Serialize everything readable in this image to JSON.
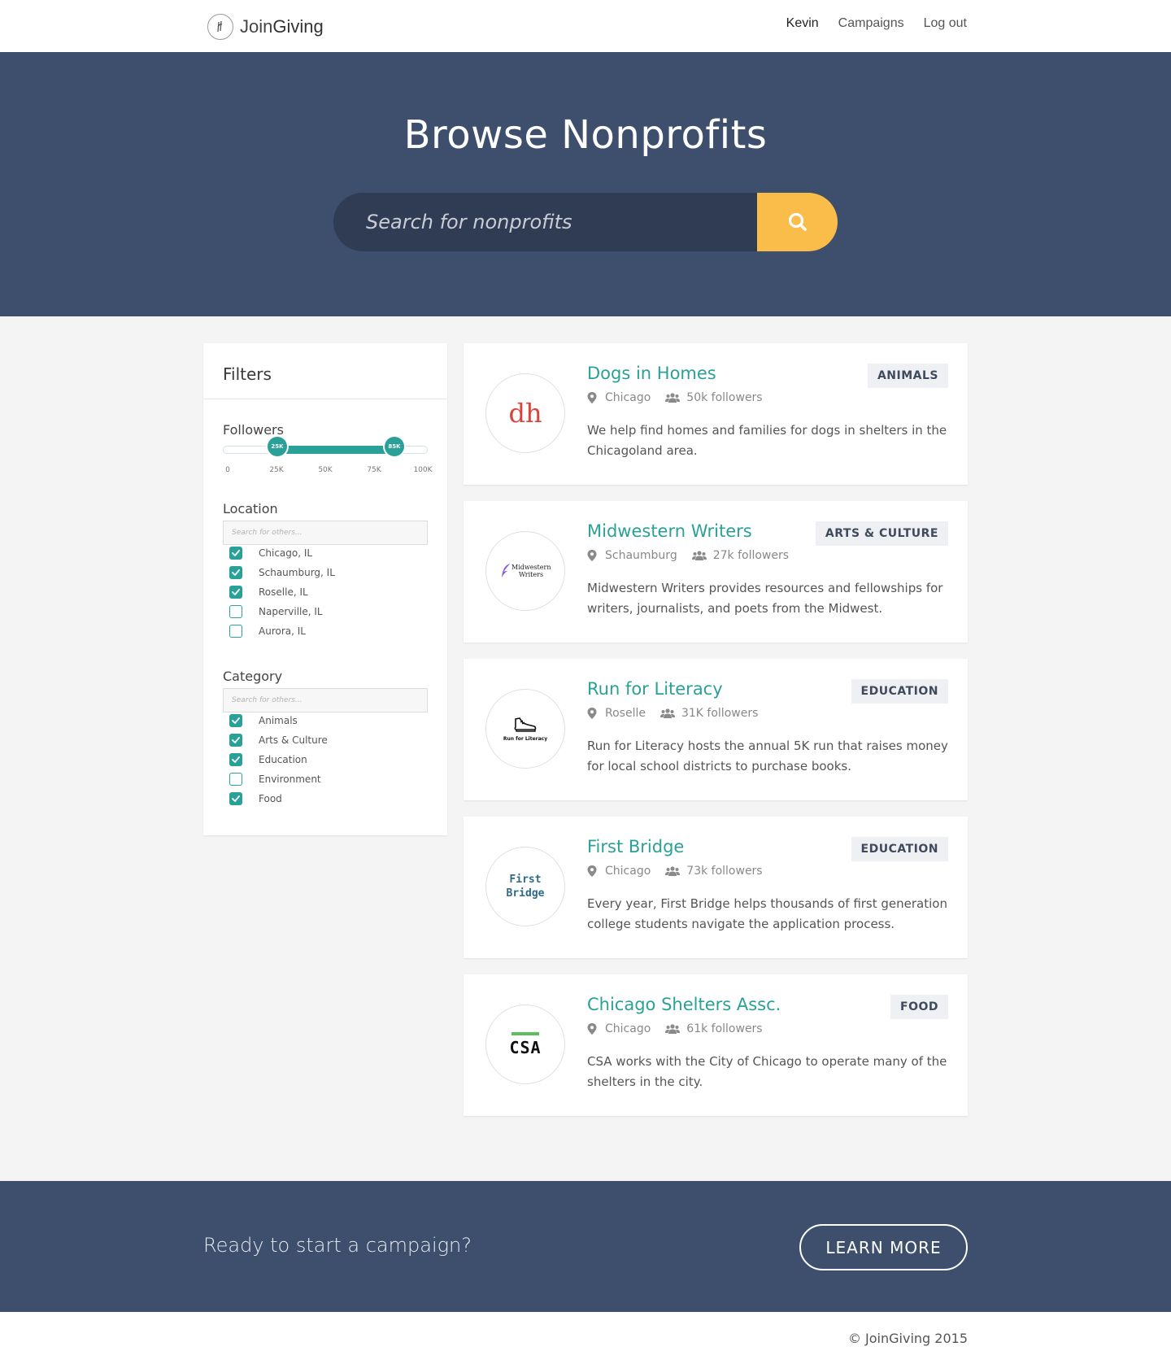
{
  "nav": {
    "brand_light": "Join",
    "brand_bold": "Giving",
    "user": "Kevin",
    "campaigns": "Campaigns",
    "logout": "Log out"
  },
  "hero": {
    "title": "Browse Nonprofits",
    "search_placeholder": "Search for nonprofits"
  },
  "filters": {
    "title": "Filters",
    "followers": {
      "label": "Followers",
      "min_label": "25K",
      "max_label": "85K",
      "range_min": 25,
      "range_max": 85,
      "ticks": [
        "0",
        "25K",
        "50K",
        "75K",
        "100K"
      ]
    },
    "location": {
      "label": "Location",
      "placeholder": "Search for others...",
      "options": [
        {
          "label": "Chicago, IL",
          "checked": true
        },
        {
          "label": "Schaumburg, IL",
          "checked": true
        },
        {
          "label": "Roselle, IL",
          "checked": true
        },
        {
          "label": "Naperville, IL",
          "checked": false
        },
        {
          "label": "Aurora, IL",
          "checked": false
        }
      ]
    },
    "category": {
      "label": "Category",
      "placeholder": "Search for others...",
      "options": [
        {
          "label": "Animals",
          "checked": true
        },
        {
          "label": "Arts & Culture",
          "checked": true
        },
        {
          "label": "Education",
          "checked": true
        },
        {
          "label": "Environment",
          "checked": false
        },
        {
          "label": "Food",
          "checked": true
        }
      ]
    }
  },
  "nonprofits": [
    {
      "name": "Dogs in Homes",
      "location": "Chicago",
      "followers": "50k followers",
      "category": "ANIMALS",
      "logo_text": "dh",
      "description": "We help find homes and families for dogs in shelters in the Chicagoland area."
    },
    {
      "name": "Midwestern Writers",
      "location": "Schaumburg",
      "followers": "27k followers",
      "category": "ARTS & CULTURE",
      "logo_text": "Midwestern Writers",
      "description": "Midwestern Writers provides resources and fellowships for writers, journalists, and poets from the Midwest."
    },
    {
      "name": "Run for Literacy",
      "location": "Roselle",
      "followers": "31K followers",
      "category": "EDUCATION",
      "logo_text": "Run for Literacy",
      "description": "Run for Literacy hosts the annual 5K run that raises money for local school districts to purchase books."
    },
    {
      "name": "First Bridge",
      "location": "Chicago",
      "followers": "73k followers",
      "category": "EDUCATION",
      "logo_text": "First Bridge",
      "description": "Every year, First Bridge helps thousands of first generation college students navigate the application process."
    },
    {
      "name": "Chicago Shelters Assc.",
      "location": "Chicago",
      "followers": "61k followers",
      "category": "FOOD",
      "logo_text": "CSA",
      "description": "CSA works with the City of Chicago to operate many of the shelters in the city."
    }
  ],
  "cta": {
    "text": "Ready to start a campaign?",
    "button": "LEARN MORE"
  },
  "footer": {
    "text": "© JoinGiving 2015"
  },
  "colors": {
    "navy": "#3d4f6c",
    "teal": "#2aa198",
    "yellow": "#fbbd4a",
    "background": "#f4f4f4"
  }
}
